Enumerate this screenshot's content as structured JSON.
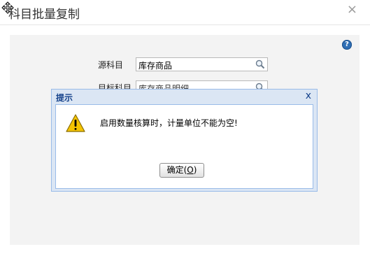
{
  "window": {
    "title": "科目批量复制",
    "close_glyph": "×"
  },
  "help": {
    "glyph": "?"
  },
  "form": {
    "source_label": "源科目",
    "source_value": "库存商品",
    "target_label": "目标科目",
    "target_value": "库存商品明细"
  },
  "dialog": {
    "title": "提示",
    "close_glyph": "x",
    "message": "启用数量核算时，计量单位不能为空!",
    "ok_text": "确定(",
    "ok_key": "O",
    "ok_close": ")"
  },
  "icons": {
    "move": "move-icon",
    "search": "search-icon",
    "warning": "warning-icon",
    "help": "help-icon"
  },
  "colors": {
    "dialog_title": "#15428b",
    "dialog_border": "#99bbe8",
    "panel_bg": "#f3f3f3",
    "warning": "#f5c400"
  }
}
